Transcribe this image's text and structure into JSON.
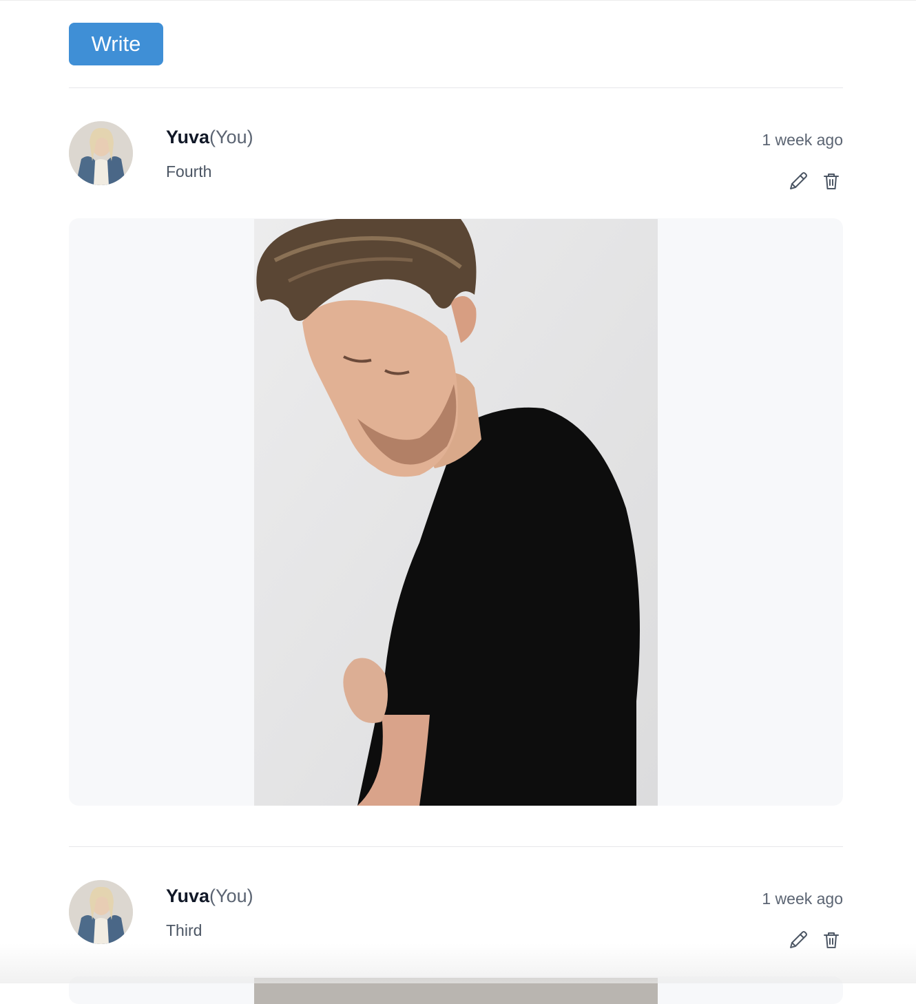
{
  "toolbar": {
    "write_label": "Write"
  },
  "posts": [
    {
      "author": "Yuva",
      "you_tag": "(You)",
      "text": "Fourth",
      "time": "1 week ago"
    },
    {
      "author": "Yuva",
      "you_tag": "(You)",
      "text": "Third",
      "time": "1 week ago"
    }
  ],
  "icons": {
    "edit": "pencil-icon",
    "delete": "trash-icon"
  },
  "colors": {
    "accent": "#3f8fd6",
    "muted_text": "#5b6472",
    "frame_bg": "#f7f8fa"
  }
}
